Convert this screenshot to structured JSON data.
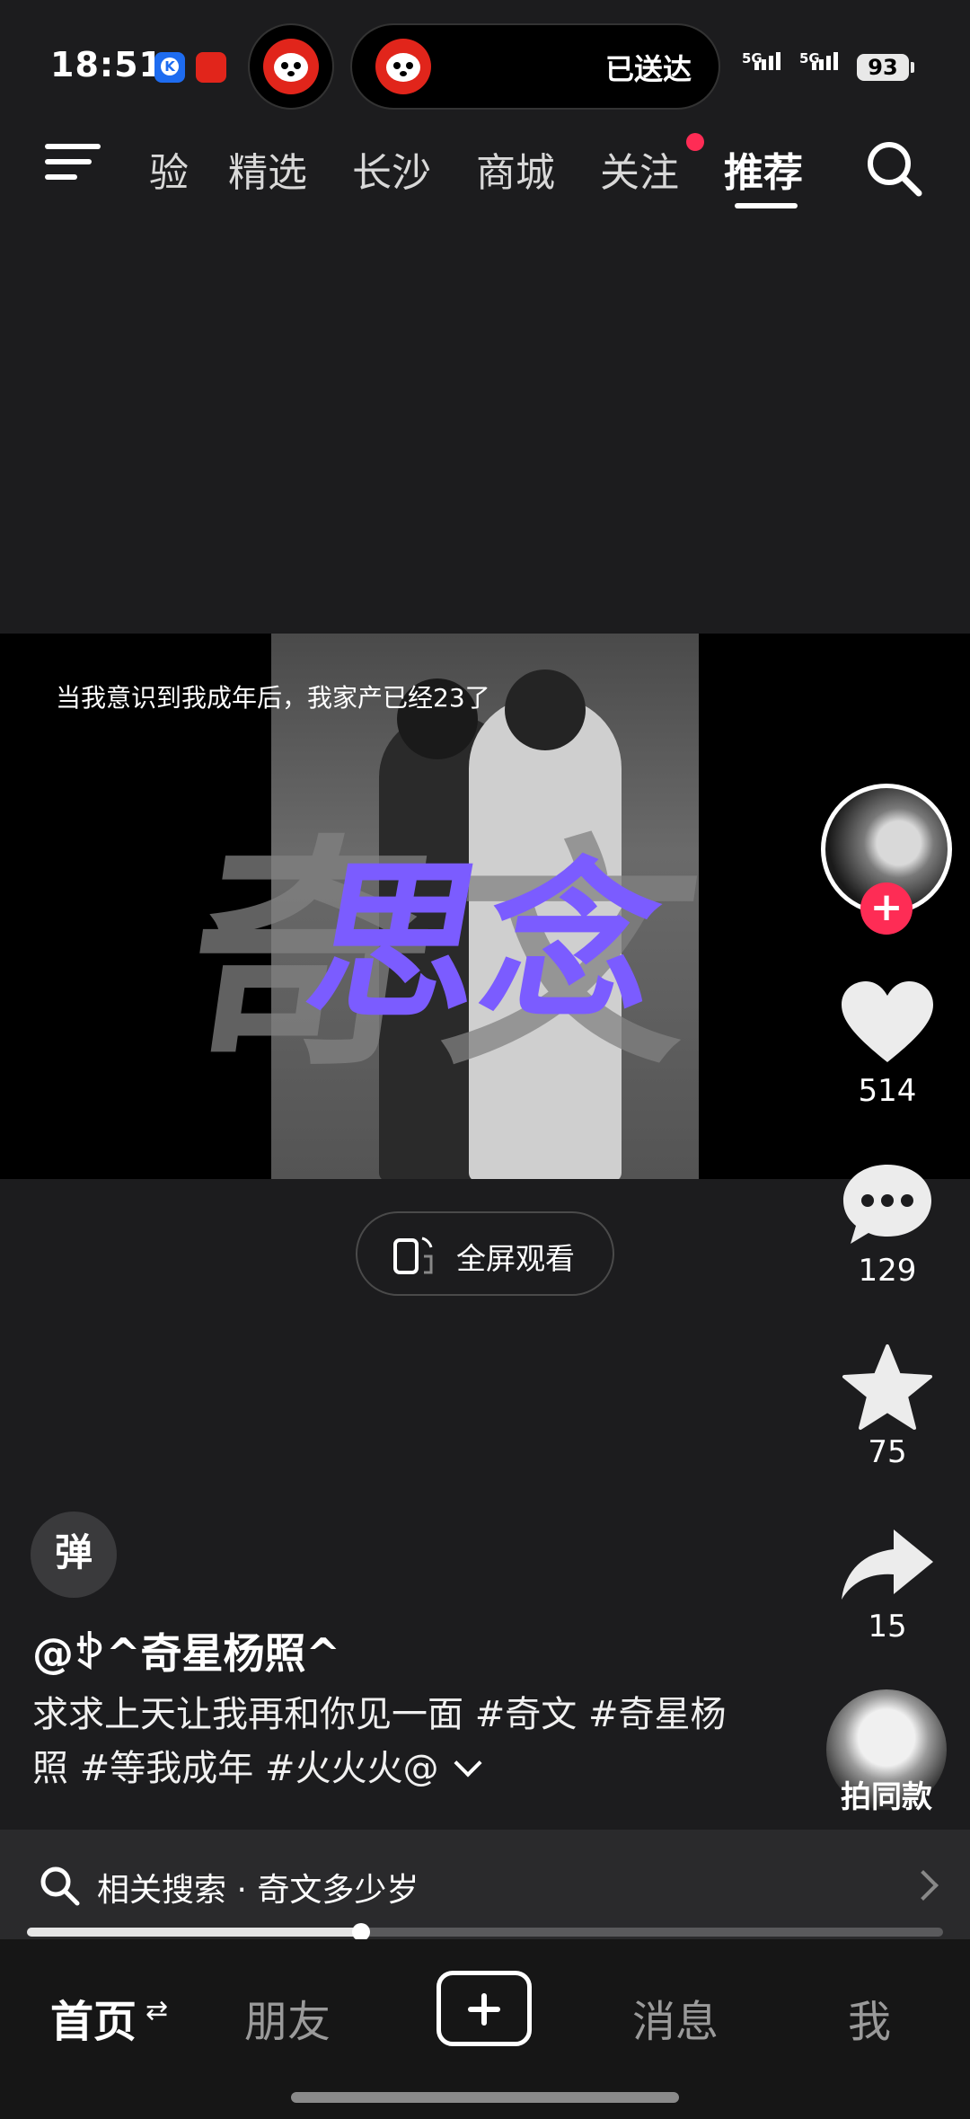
{
  "status_bar": {
    "time": "18:51",
    "live_activity_text": "已送达",
    "network_1": "5G",
    "network_2": "5G",
    "battery": "93"
  },
  "top_nav": {
    "tabs": [
      {
        "label": "验"
      },
      {
        "label": "精选"
      },
      {
        "label": "长沙"
      },
      {
        "label": "商城"
      },
      {
        "label": "关注"
      },
      {
        "label": "推荐"
      }
    ],
    "active_tab": "推荐",
    "icons": {
      "menu": "menu-icon",
      "search": "search-icon"
    }
  },
  "video": {
    "caption": "当我意识到我成年后，我家产已经23了",
    "overlay_text_gray": "奇文",
    "overlay_text_purple": "思念",
    "accent_color": "#7b5cff",
    "fullscreen_label": "全屏观看",
    "progress": 0.365
  },
  "right_rail": {
    "likes": "514",
    "comments": "129",
    "favorites": "75",
    "shares": "15",
    "remix_label": "拍同款",
    "follow_color": "#fe2c55"
  },
  "post": {
    "danmu_label": "弹",
    "author": "@ꉣ^奇星杨照^",
    "description": "求求上天让我再和你见一面 #奇文 #奇星杨照 #等我成年 #火火火@"
  },
  "related_search": {
    "label": "相关搜索 · 奇文多少岁"
  },
  "bottom_tabs": [
    {
      "label": "首页"
    },
    {
      "label": "朋友"
    },
    {
      "label": "消息"
    },
    {
      "label": "我"
    }
  ],
  "bottom_tab_swap_glyph": "⇄"
}
